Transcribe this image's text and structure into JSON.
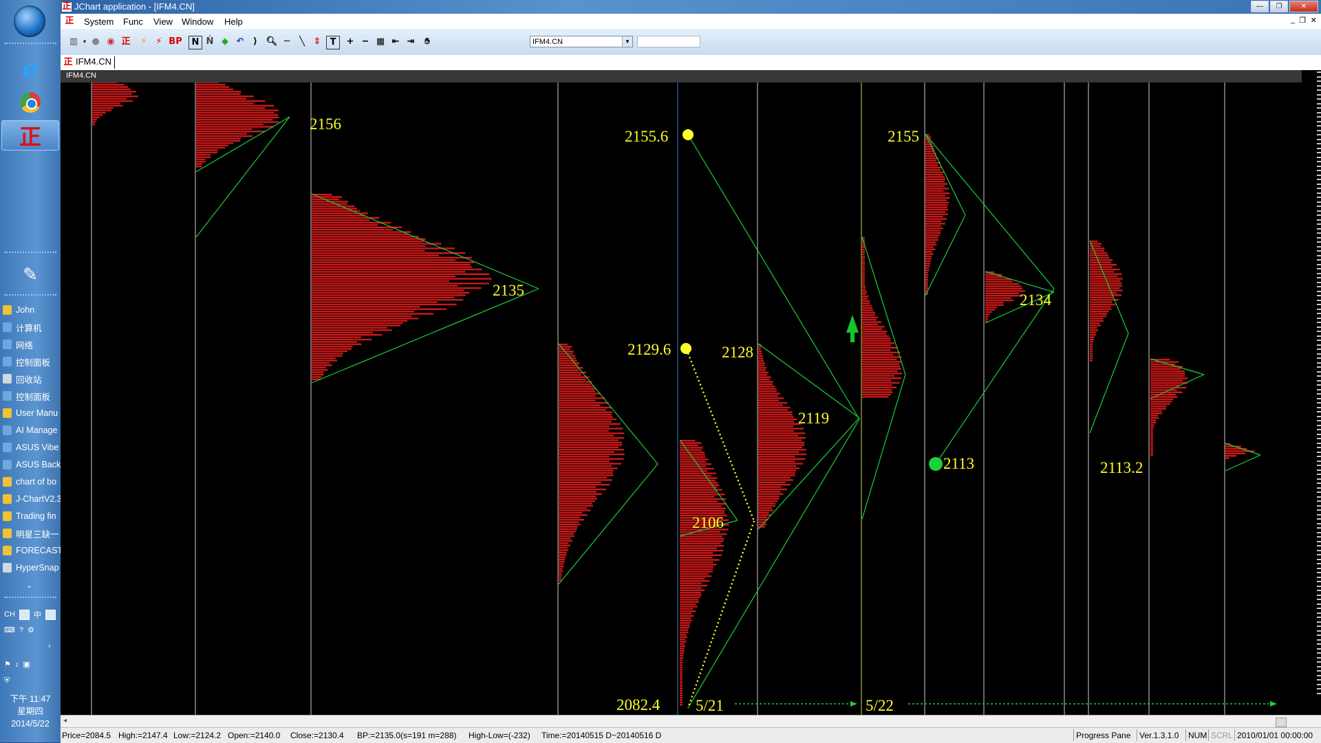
{
  "window": {
    "title": "JChart application - [IFM4.CN]",
    "tab_label": "IFM4.CN",
    "chart_header": "IFM4.CN"
  },
  "menu": {
    "system": "System",
    "func": "Func",
    "view": "View",
    "window": "Window",
    "help": "Help"
  },
  "toolbar": {
    "bp_label": "BP",
    "n_label": "N",
    "t_label": "T",
    "symbol_value": "IFM4.CN",
    "search_value": ""
  },
  "taskbar": {
    "items": [
      "John",
      "计算机",
      "网络",
      "控制面板",
      "回收站",
      "控制面板",
      "User Manu",
      "AI Manage",
      "ASUS Vibe",
      "ASUS Back",
      "chart of bo",
      "J-ChartV2.3",
      "Trading fin",
      "明星三缺一",
      "FORECAST",
      "HyperSnap"
    ],
    "lang": "CH",
    "ime": "中",
    "time": "下午 11:47",
    "weekday": "星期四",
    "date": "2014/5/22"
  },
  "annotations": {
    "p2156": "2156",
    "p2155_6": "2155.6",
    "p2155": "2155",
    "p2135": "2135",
    "p2129_6": "2129.6",
    "p2128": "2128",
    "p2119": "2119",
    "p2106": "2106",
    "p2113": "2113",
    "p2134": "2134",
    "p2113_2": "2113.2",
    "p2082_4": "2082.4",
    "d521": "5/21",
    "d522": "5/22"
  },
  "status": {
    "price": "Price=2084.5",
    "high": "High:=2147.4",
    "low": "Low:=2124.2",
    "open": "Open:=2140.0",
    "close": "Close:=2130.4",
    "bp": "BP:=2135.0(s=191 m=288)",
    "highlow": "High-Low=(-232)",
    "time": "Time:=20140515 D~20140516 D",
    "pane": "Progress Pane",
    "version": "Ver.1.3.1.0",
    "num": "NUM",
    "scrl": "SCRL",
    "clock": "2010/01/01 00:00:00"
  },
  "colors": {
    "profile": "#d01818",
    "trend": "#19d13a",
    "label": "#ffff2b",
    "up_arrow": "#16c32c"
  }
}
